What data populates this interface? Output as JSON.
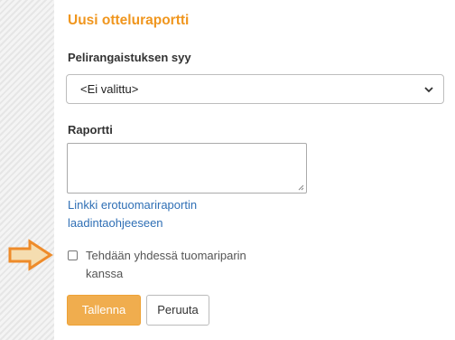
{
  "form": {
    "title": "Uusi otteluraportti",
    "penalty_reason_label": "Pelirangaistuksen syy",
    "penalty_reason_selected": "<Ei valittu>",
    "report_label": "Raportti",
    "report_value": "",
    "guide_link_line1": "Linkki erotuomariraportin",
    "guide_link_line2": "laadintaohjeeseen",
    "with_partner_line1": "Tehdään yhdessä tuomariparin",
    "with_partner_line2": "kanssa",
    "with_partner_checked": false,
    "save_label": "Tallenna",
    "cancel_label": "Peruuta"
  },
  "icons": {
    "select_indicator": "chevron-down-icon",
    "pointer": "arrow-right-icon"
  },
  "colors": {
    "title": "#f0961e",
    "save_button": "#f0ad4e",
    "link": "#2f6fb5",
    "arrow_fill": "#f5ddb0",
    "arrow_stroke": "#ee8b2a"
  }
}
